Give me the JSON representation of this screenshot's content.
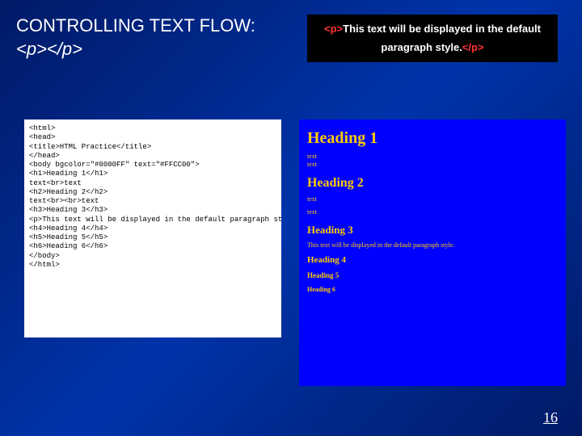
{
  "title": {
    "main": "CONTROLLING TEXT FLOW:",
    "sub": "<p></p>"
  },
  "exampleBox": {
    "open": "<p>",
    "text": "This text will be displayed in the default paragraph style.",
    "close": "</p>"
  },
  "code": "<html>\n<head>\n<title>HTML Practice</title>\n</head>\n<body bgcolor=\"#0000FF\" text=\"#FFCC00\">\n<h1>Heading 1</h1>\ntext<br>text\n<h2>Heading 2</h2>\ntext<br><br>text\n<h3>Heading 3</h3>\n<p>This text will be displayed in the default paragraph style.</p>\n<h4>Heading 4</h4>\n<h5>Heading 5</h5>\n<h6>Heading 6</h6>\n</body>\n</html>",
  "render": {
    "h1": "Heading 1",
    "h1_t1": "text",
    "h1_t2": "text",
    "h2": "Heading 2",
    "h2_t1": "text",
    "h2_t2": "text",
    "h3": "Heading 3",
    "para": "This text will be displayed in the default paragraph style.",
    "h4": "Heading 4",
    "h5": "Heading 5",
    "h6": "Heading 6"
  },
  "pageNumber": "16"
}
